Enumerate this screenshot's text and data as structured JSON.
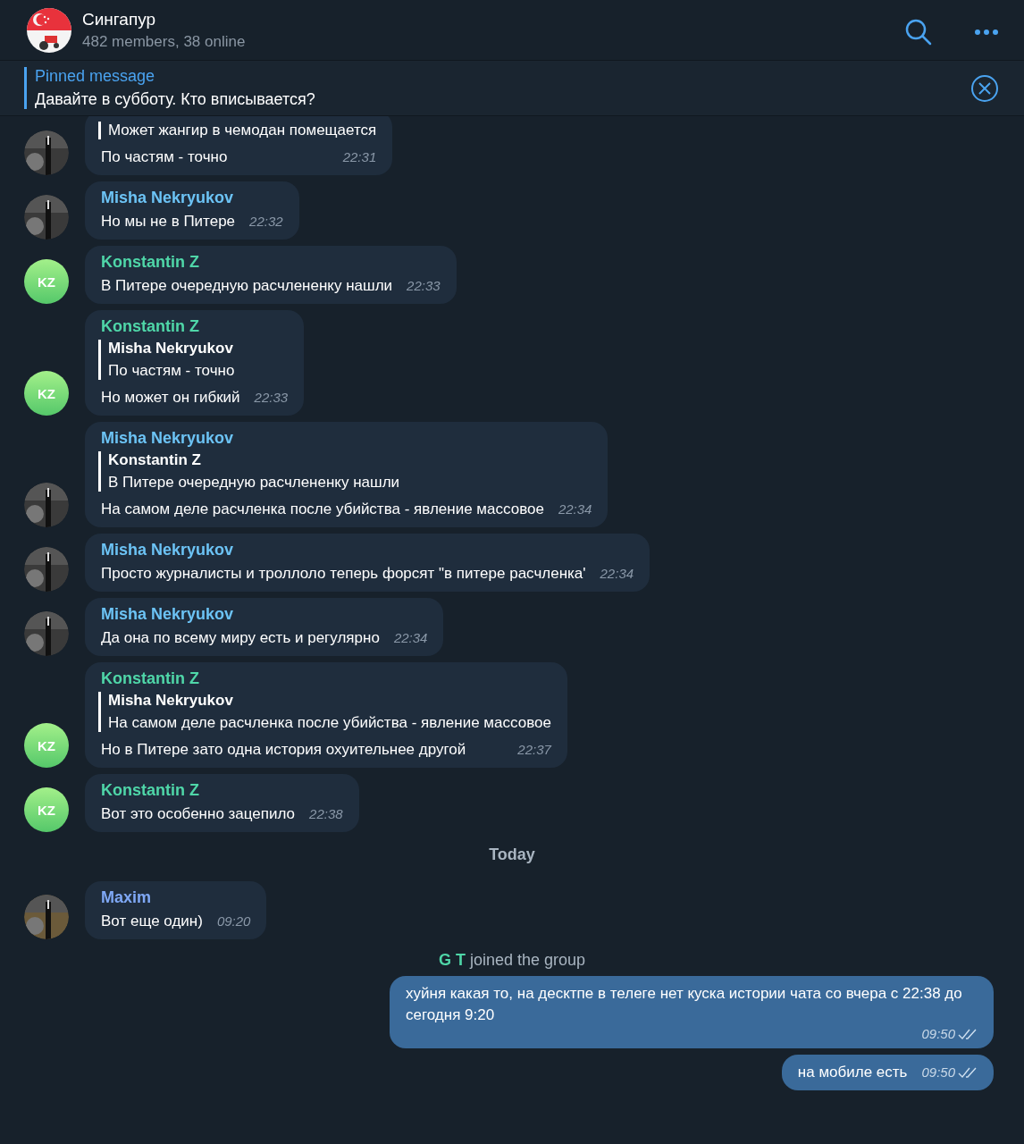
{
  "header": {
    "title": "Сингапур",
    "subtitle": "482 members, 38 online"
  },
  "pinned": {
    "label": "Pinned message",
    "text": "Давайте в субботу. Кто вписывается?"
  },
  "messages": [
    {
      "kind": "incoming",
      "reply": {
        "text": "Может жангир в чемодан помещается"
      },
      "text": "По частям - точно",
      "time": "22:31"
    },
    {
      "kind": "incoming",
      "sender": "Misha Nekryukov",
      "color": "#6cc3f5",
      "text": "Но мы не в Питере",
      "time": "22:32"
    },
    {
      "kind": "incoming",
      "avatar": {
        "kind": "initials",
        "text": "KZ"
      },
      "sender": "Konstantin Z",
      "color": "#4fd6a8",
      "text": "В Питере очередную расчлененку нашли",
      "time": "22:33"
    },
    {
      "kind": "incoming",
      "avatar": {
        "kind": "initials",
        "text": "KZ"
      },
      "sender": "Konstantin Z",
      "color": "#4fd6a8",
      "reply": {
        "name": "Misha Nekryukov",
        "text": "По частям - точно"
      },
      "text": "Но может он гибкий",
      "time": "22:33"
    },
    {
      "kind": "incoming",
      "sender": "Misha Nekryukov",
      "color": "#6cc3f5",
      "reply": {
        "name": "Konstantin Z",
        "text": "В Питере очередную расчлененку нашли"
      },
      "text": "На самом деле расчленка после убийства - явление массовое",
      "time": "22:34"
    },
    {
      "kind": "incoming",
      "sender": "Misha Nekryukov",
      "color": "#6cc3f5",
      "text": "Просто журналисты и троллоло теперь форсят \"в питере расчленка'",
      "time": "22:34"
    },
    {
      "kind": "incoming",
      "sender": "Misha Nekryukov",
      "color": "#6cc3f5",
      "text": "Да она по всему миру есть и регулярно",
      "time": "22:34"
    },
    {
      "kind": "incoming",
      "avatar": {
        "kind": "initials",
        "text": "KZ"
      },
      "sender": "Konstantin Z",
      "color": "#4fd6a8",
      "reply": {
        "name": "Misha Nekryukov",
        "text": "На самом деле расчленка после убийства - явление массовое"
      },
      "text": "Но в Питере зато одна история охуительнее другой",
      "time": "22:37"
    },
    {
      "kind": "incoming",
      "avatar": {
        "kind": "initials",
        "text": "KZ"
      },
      "sender": "Konstantin Z",
      "color": "#4fd6a8",
      "text": "Вот это особенно зацепило",
      "time": "22:38"
    },
    {
      "kind": "date",
      "text": "Today"
    },
    {
      "kind": "incoming",
      "sender": "Maxim",
      "color": "#7fa8f5",
      "text": "Вот еще один)",
      "time": "09:20"
    },
    {
      "kind": "service",
      "name": "G T",
      "color": "#4fd6a8",
      "text": "joined the group"
    },
    {
      "kind": "outgoing",
      "text": "хуйня какая то, на десктпе в телеге нет куска истории чата со вчера с 22:38 до сегодня 9:20",
      "time": "09:50",
      "read": true
    },
    {
      "kind": "outgoing",
      "text": "на мобиле есть",
      "time": "09:50",
      "read": true
    }
  ]
}
